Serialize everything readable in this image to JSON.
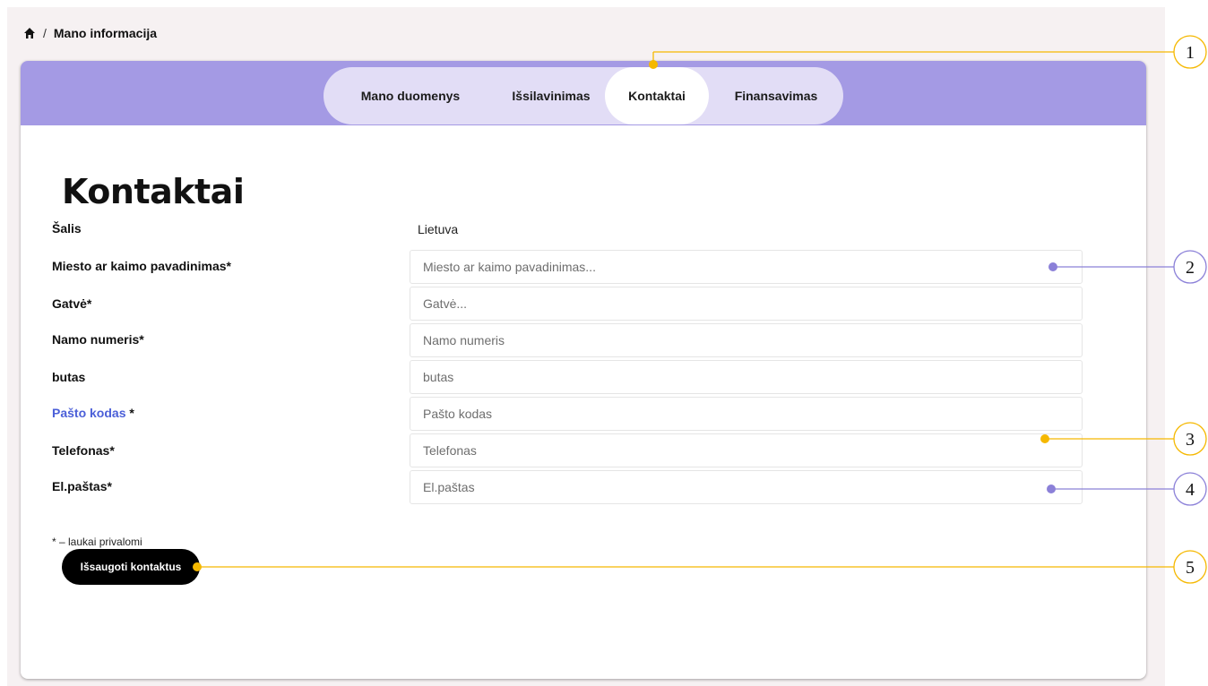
{
  "breadcrumb": {
    "home_icon": "home-icon",
    "separator": "/",
    "current": "Mano informacija"
  },
  "tabs": [
    {
      "label": "Mano duomenys",
      "active": false
    },
    {
      "label": "Išsilavinimas",
      "active": false
    },
    {
      "label": "Kontaktai",
      "active": true
    },
    {
      "label": "Finansavimas",
      "active": false
    }
  ],
  "page": {
    "title": "Kontaktai"
  },
  "form": {
    "country": {
      "label": "Šalis",
      "value": "Lietuva"
    },
    "city": {
      "label": "Miesto ar kaimo pavadinimas*",
      "placeholder": "Miesto ar kaimo pavadinimas..."
    },
    "street": {
      "label": "Gatvė*",
      "placeholder": "Gatvė..."
    },
    "house": {
      "label": "Namo numeris*",
      "placeholder": "Namo numeris"
    },
    "flat": {
      "label": "butas",
      "placeholder": "butas"
    },
    "postal": {
      "label": "Pašto kodas",
      "required_mark": " *",
      "placeholder": "Pašto kodas"
    },
    "phone": {
      "label": "Telefonas*",
      "placeholder": "Telefonas"
    },
    "email": {
      "label": "El.paštas*",
      "placeholder": "El.paštas"
    },
    "required_note": "* – laukai privalomi",
    "save_label": "Išsaugoti kontaktus"
  },
  "callouts": [
    "1",
    "2",
    "3",
    "4",
    "5"
  ],
  "colors": {
    "header_bg": "#a49ae4",
    "tabs_bg": "#e2ddf6",
    "callout_yellow": "#f5b800",
    "callout_purple": "#8b80d8",
    "link_blue": "#4b5fd8"
  }
}
